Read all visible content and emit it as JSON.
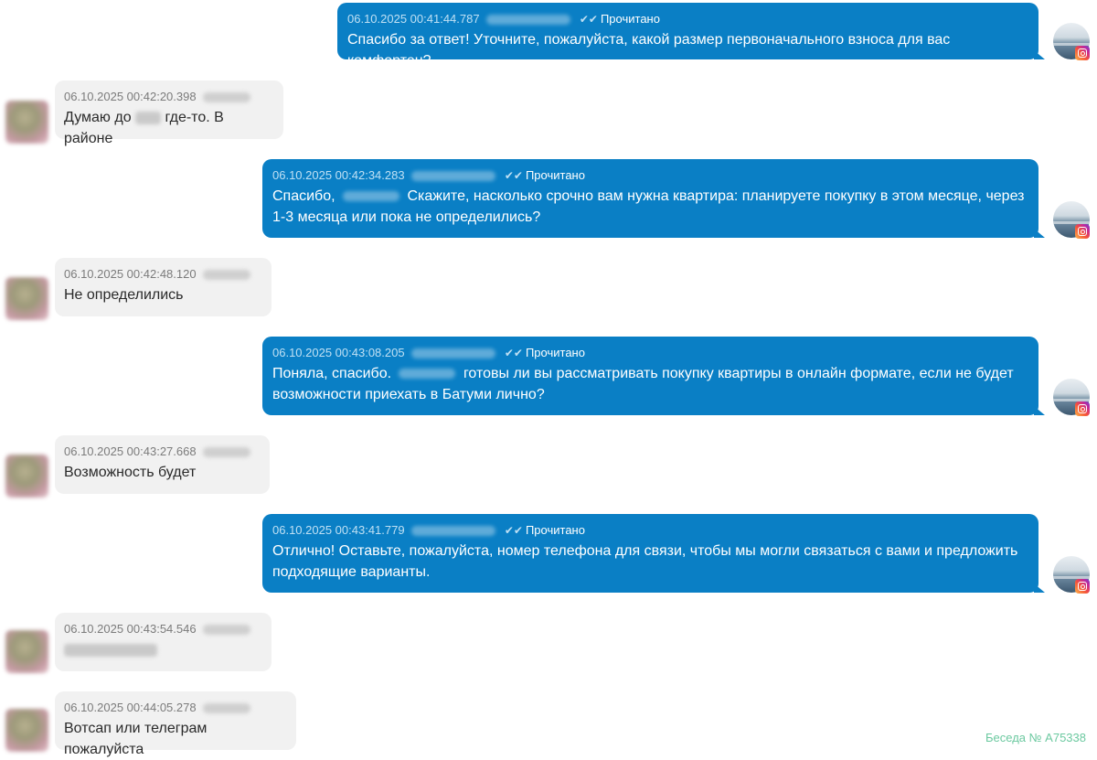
{
  "messages": [
    {
      "direction": "out",
      "timestamp": "06.10.2025 00:41:44.787",
      "status": "Прочитано",
      "text": "Спасибо за ответ! Уточните, пожалуйста, какой размер первоначального взноса для вас комфортен?"
    },
    {
      "direction": "in",
      "timestamp": "06.10.2025 00:42:20.398",
      "text_before": "Думаю до",
      "text_after": "где-то. В районе"
    },
    {
      "direction": "out",
      "timestamp": "06.10.2025 00:42:34.283",
      "status": "Прочитано",
      "text_start": "Спасибо,",
      "text_line1": "Скажите, насколько срочно вам нужна квартира: планируете покупку в этом месяце, через",
      "text_line2": "1-3 месяца или пока не определились?"
    },
    {
      "direction": "in",
      "timestamp": "06.10.2025 00:42:48.120",
      "text": "Не определились"
    },
    {
      "direction": "out",
      "timestamp": "06.10.2025 00:43:08.205",
      "status": "Прочитано",
      "text_start": "Поняла, спасибо.",
      "text_line1": "готовы ли вы рассматривать покупку квартиры в онлайн формате, если не будет",
      "text_line2": "возможности приехать в Батуми лично?"
    },
    {
      "direction": "in",
      "timestamp": "06.10.2025 00:43:27.668",
      "text": "Возможность будет"
    },
    {
      "direction": "out",
      "timestamp": "06.10.2025 00:43:41.779",
      "status": "Прочитано",
      "text_line1": "Отлично! Оставьте, пожалуйста, номер телефона для связи, чтобы мы могли связаться с вами и предложить",
      "text_line2": "подходящие варианты."
    },
    {
      "direction": "in",
      "timestamp": "06.10.2025 00:43:54.546",
      "text": ""
    },
    {
      "direction": "in",
      "timestamp": "06.10.2025 00:44:05.278",
      "text": "Вотсап или телеграм пожалуйста"
    }
  ],
  "icons": {
    "read_check": "double-check-icon",
    "channel": "instagram-icon"
  },
  "conversation_id": "Беседа № А75338",
  "colors": {
    "outgoing": "#0a7fc5",
    "incoming": "#f1f1f1",
    "conv_id": "#6cc9a0"
  }
}
